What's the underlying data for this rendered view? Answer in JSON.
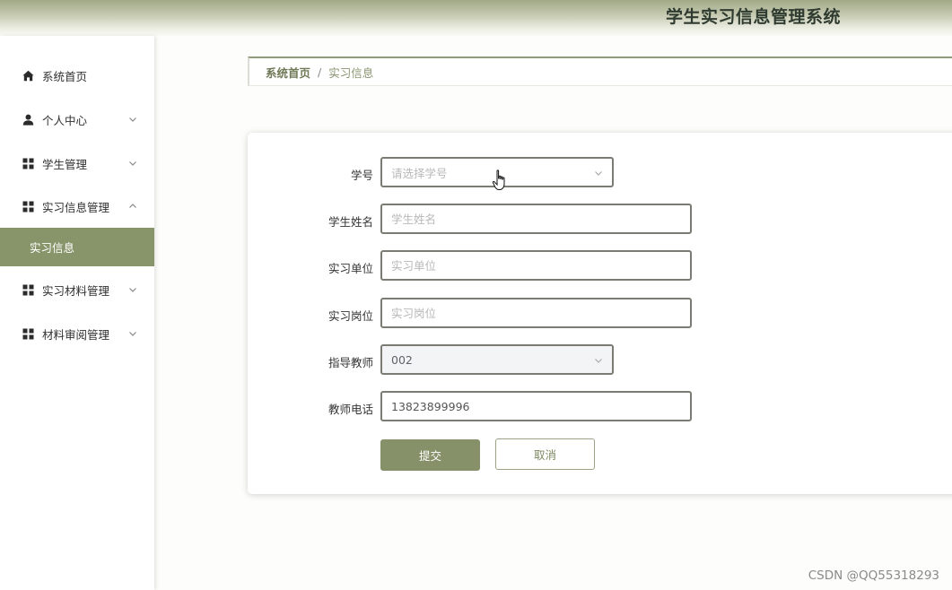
{
  "header": {
    "title": "学生实习信息管理系统"
  },
  "sidebar": {
    "items": [
      {
        "label": "系统首页",
        "icon": "home-icon"
      },
      {
        "label": "个人中心",
        "icon": "user-icon",
        "expanded": false
      },
      {
        "label": "学生管理",
        "icon": "grid-icon",
        "expanded": false
      },
      {
        "label": "实习信息管理",
        "icon": "grid-icon",
        "expanded": true
      },
      {
        "label": "实习材料管理",
        "icon": "grid-icon",
        "expanded": false
      },
      {
        "label": "材料审阅管理",
        "icon": "grid-icon",
        "expanded": false
      }
    ],
    "submenu": {
      "label": "实习信息",
      "active": true
    }
  },
  "breadcrumb": {
    "home": "系统首页",
    "separator": "/",
    "current": "实习信息"
  },
  "form": {
    "student_id": {
      "label": "学号",
      "placeholder": "请选择学号"
    },
    "student_name": {
      "label": "学生姓名",
      "placeholder": "学生姓名",
      "value": ""
    },
    "company": {
      "label": "实习单位",
      "placeholder": "实习单位",
      "value": ""
    },
    "position": {
      "label": "实习岗位",
      "placeholder": "实习岗位",
      "value": ""
    },
    "teacher": {
      "label": "指导教师",
      "value": "002",
      "disabled": true
    },
    "teacher_phone": {
      "label": "教师电话",
      "value": "13823899996"
    },
    "submit_label": "提交",
    "cancel_label": "取消"
  },
  "watermark": "CSDN @QQ55318293",
  "colors": {
    "accent": "#86916a",
    "header_top": "#a2a986",
    "title_text": "#2f3b30"
  }
}
